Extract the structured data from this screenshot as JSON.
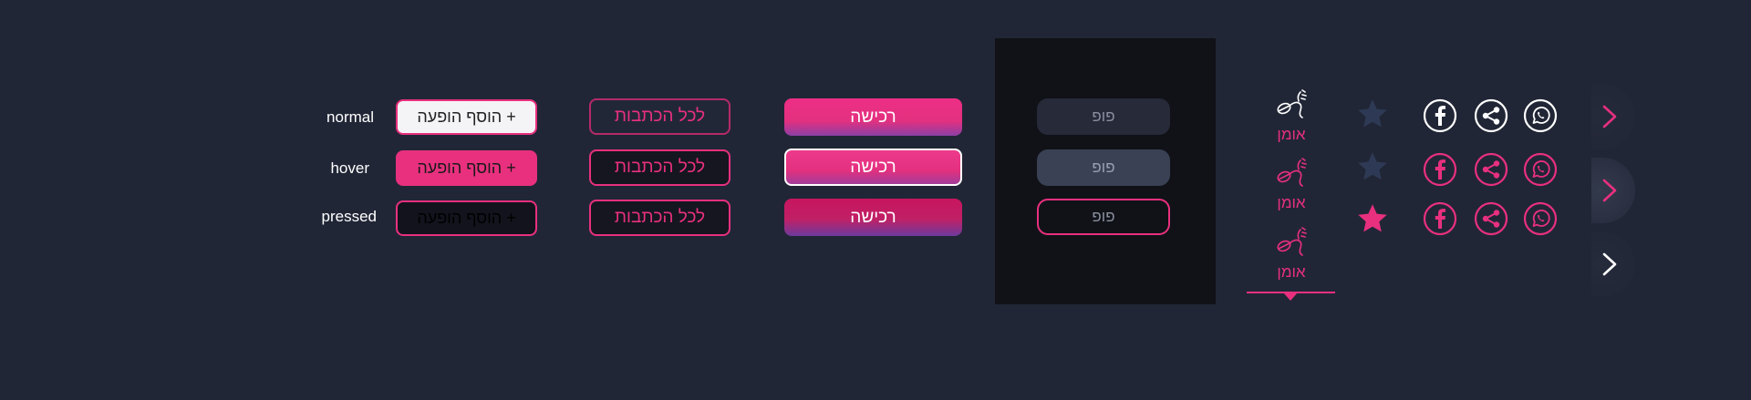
{
  "states": {
    "normal": "normal",
    "hover": "hover",
    "pressed": "pressed"
  },
  "buttons": {
    "add_event": "+ הוסף הופעה",
    "all_writings": "לכל הכתבות",
    "purchase": "רכישה",
    "pop": "פופ"
  },
  "artist_tab": {
    "label": "אומן",
    "icon": "singer-microphone-icon"
  },
  "icons": {
    "star": "star-icon",
    "facebook": "facebook-icon",
    "share": "share-icon",
    "whatsapp": "whatsapp-icon",
    "arrow": "chevron-right-icon"
  },
  "colors": {
    "background": "#212636",
    "accent": "#e8307e",
    "panel": "#101217",
    "purple": "#8c3fa6",
    "inactive_star": "#2e3a55"
  }
}
